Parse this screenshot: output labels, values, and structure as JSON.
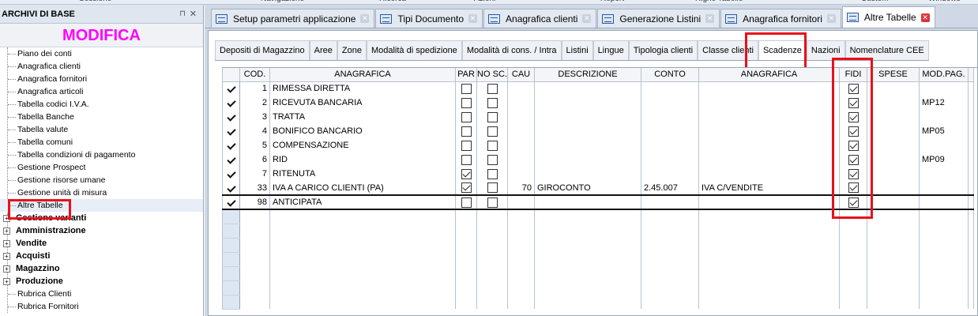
{
  "menu": [
    "Sessione",
    "Navigazione",
    "Ricerca",
    "Azioni",
    "Report",
    "Righe Tabelle",
    "Custom",
    "Windows"
  ],
  "left_panel": {
    "title": "ARCHIVI DI BASE",
    "banner": "MODIFICA",
    "items": [
      {
        "label": "Piano dei conti",
        "kind": "child"
      },
      {
        "label": "Anagrafica clienti",
        "kind": "child"
      },
      {
        "label": "Anagrafica fornitori",
        "kind": "child"
      },
      {
        "label": "Anagrafica articoli",
        "kind": "child"
      },
      {
        "label": "Tabella codici I.V.A.",
        "kind": "child"
      },
      {
        "label": "Tabella Banche",
        "kind": "child"
      },
      {
        "label": "Tabella valute",
        "kind": "child"
      },
      {
        "label": "Tabella comuni",
        "kind": "child"
      },
      {
        "label": "Tabella condizioni di pagamento",
        "kind": "child"
      },
      {
        "label": "Gestione Prospect",
        "kind": "child"
      },
      {
        "label": "Gestione risorse umane",
        "kind": "child"
      },
      {
        "label": "Gestione unità di misura",
        "kind": "child"
      },
      {
        "label": "Altre Tabelle",
        "kind": "child"
      },
      {
        "label": "Gestione varianti",
        "kind": "group"
      },
      {
        "label": "Amministrazione",
        "kind": "group"
      },
      {
        "label": "Vendite",
        "kind": "group"
      },
      {
        "label": "Acquisti",
        "kind": "group"
      },
      {
        "label": "Magazzino",
        "kind": "group"
      },
      {
        "label": "Produzione",
        "kind": "group"
      },
      {
        "label": "Rubrica Clienti",
        "kind": "child"
      },
      {
        "label": "Rubrica Fornitori",
        "kind": "child"
      }
    ]
  },
  "doc_tabs": [
    {
      "label": "Setup parametri applicazione",
      "active": false
    },
    {
      "label": "Tipi Documento",
      "active": false
    },
    {
      "label": "Anagrafica clienti",
      "active": false
    },
    {
      "label": "Generazione Listini",
      "active": false
    },
    {
      "label": "Anagrafica fornitori",
      "active": false
    },
    {
      "label": "Altre Tabelle",
      "active": true
    }
  ],
  "sub_tabs": [
    {
      "label": "Depositi di Magazzino",
      "active": false
    },
    {
      "label": "Aree",
      "active": false
    },
    {
      "label": "Zone",
      "active": false
    },
    {
      "label": "Modalità di spedizione",
      "active": false
    },
    {
      "label": "Modalità di cons. / Intra",
      "active": false
    },
    {
      "label": "Listini",
      "active": false
    },
    {
      "label": "Lingue",
      "active": false
    },
    {
      "label": "Tipologia clienti",
      "active": false
    },
    {
      "label": "Classe clienti",
      "active": false
    },
    {
      "label": "Scadenze",
      "active": true
    },
    {
      "label": "Nazioni",
      "active": false
    },
    {
      "label": "Nomenclature CEE",
      "active": false
    }
  ],
  "grid": {
    "columns": [
      "COD.",
      "ANAGRAFICA",
      "PAR",
      "NO SC.",
      "CAU",
      "DESCRIZIONE",
      "CONTO",
      "ANAGRAFICA",
      "FIDI",
      "SPESE",
      "MOD.PAG."
    ],
    "rows": [
      {
        "cod": "1",
        "anagrafica": "RIMESSA DIRETTA",
        "par": false,
        "nosc": false,
        "cau": "",
        "descrizione": "",
        "conto": "",
        "anagrafica2": "",
        "fidi": true,
        "spese": "",
        "modpag": ""
      },
      {
        "cod": "2",
        "anagrafica": "RICEVUTA BANCARIA",
        "par": false,
        "nosc": false,
        "cau": "",
        "descrizione": "",
        "conto": "",
        "anagrafica2": "",
        "fidi": true,
        "spese": "",
        "modpag": "MP12"
      },
      {
        "cod": "3",
        "anagrafica": "TRATTA",
        "par": false,
        "nosc": false,
        "cau": "",
        "descrizione": "",
        "conto": "",
        "anagrafica2": "",
        "fidi": true,
        "spese": "",
        "modpag": ""
      },
      {
        "cod": "4",
        "anagrafica": "BONIFICO BANCARIO",
        "par": false,
        "nosc": false,
        "cau": "",
        "descrizione": "",
        "conto": "",
        "anagrafica2": "",
        "fidi": true,
        "spese": "",
        "modpag": "MP05"
      },
      {
        "cod": "5",
        "anagrafica": "COMPENSAZIONE",
        "par": false,
        "nosc": false,
        "cau": "",
        "descrizione": "",
        "conto": "",
        "anagrafica2": "",
        "fidi": true,
        "spese": "",
        "modpag": ""
      },
      {
        "cod": "6",
        "anagrafica": "RID",
        "par": false,
        "nosc": false,
        "cau": "",
        "descrizione": "",
        "conto": "",
        "anagrafica2": "",
        "fidi": true,
        "spese": "",
        "modpag": "MP09"
      },
      {
        "cod": "7",
        "anagrafica": "RITENUTA",
        "par": true,
        "nosc": false,
        "cau": "",
        "descrizione": "",
        "conto": "",
        "anagrafica2": "",
        "fidi": true,
        "spese": "",
        "modpag": ""
      },
      {
        "cod": "33",
        "anagrafica": "IVA A CARICO CLIENTI (PA)",
        "par": true,
        "nosc": false,
        "cau": "70",
        "descrizione": "GIROCONTO",
        "conto": "2.45.007",
        "anagrafica2": "IVA C/VENDITE",
        "fidi": true,
        "spese": "",
        "modpag": ""
      },
      {
        "cod": "98",
        "anagrafica": "ANTICIPATA",
        "par": false,
        "nosc": false,
        "cau": "",
        "descrizione": "",
        "conto": "",
        "anagrafica2": "",
        "fidi": true,
        "spese": "",
        "modpag": ""
      }
    ]
  }
}
